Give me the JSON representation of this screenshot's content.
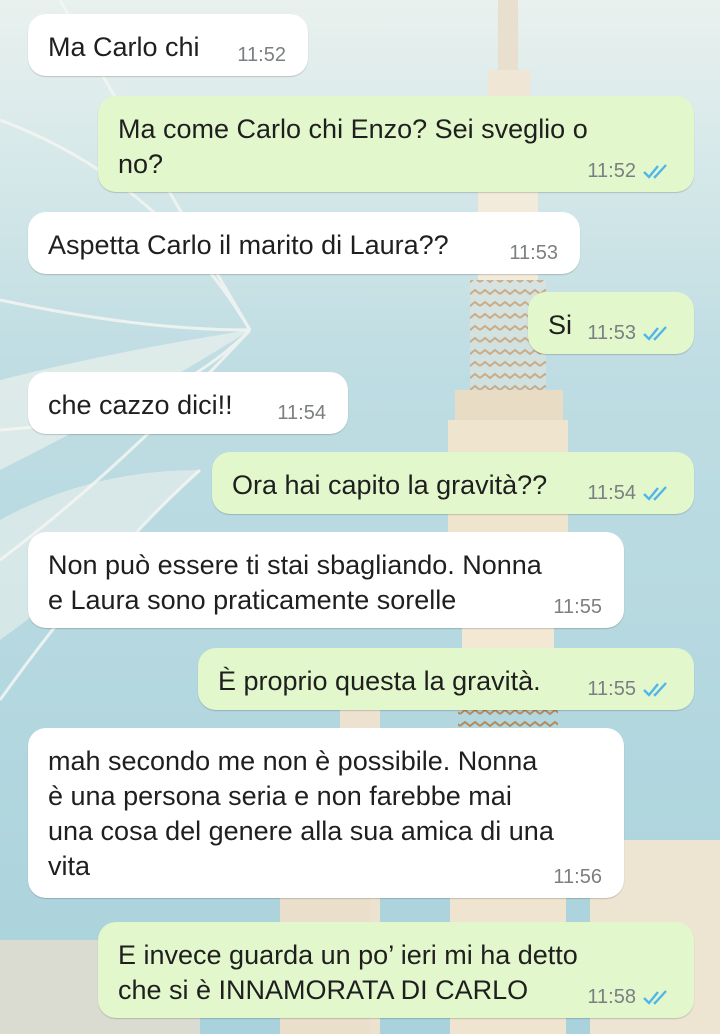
{
  "colors": {
    "incoming_bubble": "#ffffff",
    "outgoing_bubble": "#e2f7cb",
    "time_text": "#7b7f82",
    "read_check": "#4fb6ec"
  },
  "messages": [
    {
      "dir": "in",
      "text": "Ma Carlo chi",
      "time": "11:52"
    },
    {
      "dir": "out",
      "text": "Ma come Carlo chi Enzo? Sei sveglio o\nno?",
      "time": "11:52",
      "status_icon": "double-check-read-icon"
    },
    {
      "dir": "in",
      "text": "Aspetta Carlo il marito di Laura??",
      "time": "11:53"
    },
    {
      "dir": "out",
      "text": "Si",
      "time": "11:53",
      "status_icon": "double-check-read-icon"
    },
    {
      "dir": "in",
      "text": "che cazzo dici!!",
      "time": "11:54"
    },
    {
      "dir": "out",
      "text": "Ora hai capito la gravità??",
      "time": "11:54",
      "status_icon": "double-check-read-icon"
    },
    {
      "dir": "in",
      "text": "Non può essere ti stai sbagliando. Nonna\ne Laura sono praticamente sorelle",
      "time": "11:55"
    },
    {
      "dir": "out",
      "text": "È proprio questa la gravità.",
      "time": "11:55",
      "status_icon": "double-check-read-icon"
    },
    {
      "dir": "in",
      "text": "mah secondo me non è possibile. Nonna\nè una persona seria e non farebbe mai\nuna cosa del genere alla sua amica di una\nvita",
      "time": "11:56"
    },
    {
      "dir": "out",
      "text": "E invece guarda un po’ ieri mi ha detto\nche si è INNAMORATA DI CARLO",
      "time": "11:58",
      "status_icon": "double-check-read-icon"
    }
  ]
}
